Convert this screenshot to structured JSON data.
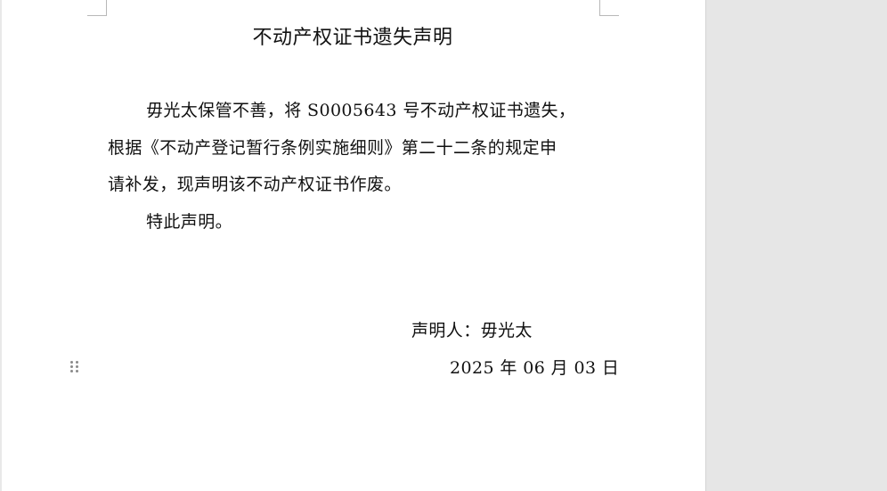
{
  "document": {
    "title": "不动产权证书遗失声明",
    "paragraph1_line1": "毋光太保管不善，将 S0005643 号不动产权证书遗失，",
    "paragraph1_line2": "根据《不动产登记暂行条例实施细则》第二十二条的规定申",
    "paragraph1_line3": "请补发，现声明该不动产权证书作废。",
    "paragraph2": "特此声明。",
    "signer": "声明人：毋光太",
    "date": "2025 年 06 月 03 日"
  },
  "icons": {
    "drag_handle": "drag-handle-icon"
  },
  "colors": {
    "page_background": "#ffffff",
    "workspace_background": "#e6e6e6",
    "text": "#111111"
  }
}
